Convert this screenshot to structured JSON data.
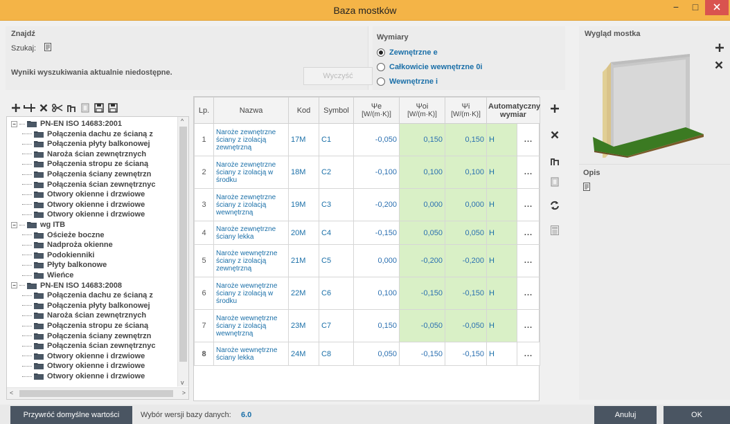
{
  "window": {
    "title": "Baza mostków",
    "min_label": "−",
    "max_label": "□"
  },
  "find": {
    "title": "Znajdź",
    "search_label": "Szukaj:",
    "results_message": "Wyniki wyszukiwania aktualnie niedostępne.",
    "clear_label": "Wyczyść"
  },
  "dimensions": {
    "title": "Wymiary",
    "options": [
      {
        "label": "Zewnętrzne e",
        "checked": true
      },
      {
        "label": "Całkowicie wewnętrzne 0i",
        "checked": false
      },
      {
        "label": "Wewnętrzne i",
        "checked": false
      }
    ]
  },
  "preview": {
    "title": "Wygląd mostka",
    "opis_title": "Opis"
  },
  "tree": {
    "rows": [
      {
        "label": "PN-EN ISO 14683:2001",
        "root": true
      },
      {
        "label": "Połączenia dachu ze ścianą z",
        "root": false
      },
      {
        "label": "Połączenia płyty balkonowej",
        "root": false
      },
      {
        "label": "Naroża ścian zewnętrznych",
        "root": false
      },
      {
        "label": "Połączenia stropu ze ścianą",
        "root": false
      },
      {
        "label": "Połączenia ściany zewnętrzn",
        "root": false
      },
      {
        "label": "Połączenia ścian zewnętrznyc",
        "root": false
      },
      {
        "label": "Otwory okienne i drzwiowe",
        "root": false
      },
      {
        "label": "Otwory okienne i drzwiowe",
        "root": false
      },
      {
        "label": "Otwory okienne i drzwiowe",
        "root": false
      },
      {
        "label": "wg ITB",
        "root": true
      },
      {
        "label": "Ościeże boczne",
        "root": false
      },
      {
        "label": "Nadproża okienne",
        "root": false
      },
      {
        "label": "Podokienniki",
        "root": false
      },
      {
        "label": "Płyty balkonowe",
        "root": false
      },
      {
        "label": "Wieńce",
        "root": false
      },
      {
        "label": "PN-EN ISO 14683:2008",
        "root": true
      },
      {
        "label": "Połączenia dachu ze ścianą z",
        "root": false
      },
      {
        "label": "Połączenia płyty balkonowej",
        "root": false
      },
      {
        "label": "Naroża ścian zewnętrznych",
        "root": false
      },
      {
        "label": "Połączenia stropu ze ścianą",
        "root": false
      },
      {
        "label": "Połączenia ściany zewnętrzn",
        "root": false
      },
      {
        "label": "Połączenia ścian zewnętrznyc",
        "root": false
      },
      {
        "label": "Otwory okienne i drzwiowe",
        "root": false
      },
      {
        "label": "Otwory okienne i drzwiowe",
        "root": false
      },
      {
        "label": "Otwory okienne i drzwiowe",
        "root": false
      }
    ]
  },
  "grid": {
    "headers": {
      "lp": "Lp.",
      "name": "Nazwa",
      "code": "Kod",
      "symbol": "Symbol",
      "psi_e": "Ψe",
      "psi_oi": "Ψoi",
      "psi_i": "Ψi",
      "unit": "[W/(m·K)]",
      "auto": "Automatyczny wymiar"
    },
    "rows": [
      {
        "lp": "1",
        "name": "Naroże zewnętrzne ściany z izolacją zewnętrzną",
        "code": "17M",
        "symbol": "C1",
        "psi_e": "-0,050",
        "psi_oi": "0,150",
        "psi_i": "0,150",
        "auto": "H",
        "more": "..."
      },
      {
        "lp": "2",
        "name": "Naroże zewnętrzne ściany z izolacją w środku",
        "code": "18M",
        "symbol": "C2",
        "psi_e": "-0,100",
        "psi_oi": "0,100",
        "psi_i": "0,100",
        "auto": "H",
        "more": "..."
      },
      {
        "lp": "3",
        "name": "Naroże zewnętrzne ściany z izolacją wewnętrzną",
        "code": "19M",
        "symbol": "C3",
        "psi_e": "-0,200",
        "psi_oi": "0,000",
        "psi_i": "0,000",
        "auto": "H",
        "more": "..."
      },
      {
        "lp": "4",
        "name": "Naroże zewnętrzne ściany lekka",
        "code": "20M",
        "symbol": "C4",
        "psi_e": "-0,150",
        "psi_oi": "0,050",
        "psi_i": "0,050",
        "auto": "H",
        "more": "..."
      },
      {
        "lp": "5",
        "name": "Naroże wewnętrzne ściany z izolacją zewnętrzną",
        "code": "21M",
        "symbol": "C5",
        "psi_e": "0,000",
        "psi_oi": "-0,200",
        "psi_i": "-0,200",
        "auto": "H",
        "more": "..."
      },
      {
        "lp": "6",
        "name": "Naroże wewnętrzne ściany z izolacją w środku",
        "code": "22M",
        "symbol": "C6",
        "psi_e": "0,100",
        "psi_oi": "-0,150",
        "psi_i": "-0,150",
        "auto": "H",
        "more": "..."
      },
      {
        "lp": "7",
        "name": "Naroże wewnętrzne ściany z izolacją wewnętrzną",
        "code": "23M",
        "symbol": "C7",
        "psi_e": "0,150",
        "psi_oi": "-0,050",
        "psi_i": "-0,050",
        "auto": "H",
        "more": "..."
      },
      {
        "lp": "8",
        "name": "Naroże wewnętrzne ściany lekka",
        "code": "24M",
        "symbol": "C8",
        "psi_e": "0,050",
        "psi_oi": "-0,150",
        "psi_i": "-0,150",
        "auto": "H",
        "more": "..."
      }
    ]
  },
  "footer": {
    "restore_label": "Przywróć domyślne wartości",
    "db_label": "Wybór wersji bazy danych:",
    "db_value": "6.0",
    "cancel_label": "Anuluj",
    "ok_label": "OK"
  },
  "colors": {
    "accent": "#f4b447",
    "link": "#1a6fa8",
    "psi_bg": "#d9f0c6",
    "button_bg": "#4a5562"
  }
}
